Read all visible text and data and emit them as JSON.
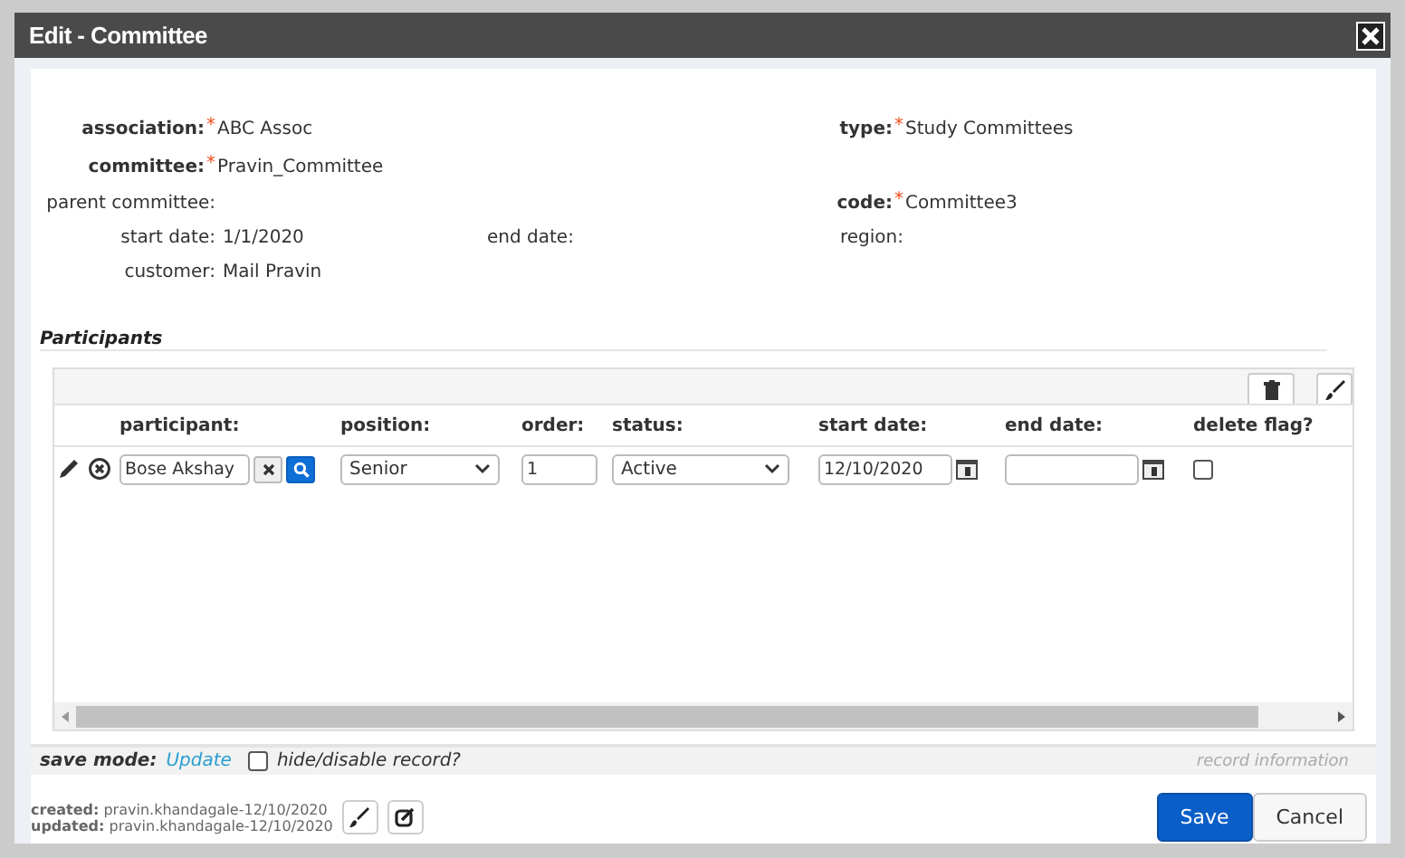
{
  "window": {
    "title": "Edit - Committee"
  },
  "field_rows": [
    {
      "left": {
        "label": "association:",
        "mark": "*",
        "value": "ABC Assoc",
        "strong": true
      },
      "right": {
        "label": "type:",
        "mark": "*",
        "value": "Study Committees",
        "strong": true
      }
    },
    {
      "left": {
        "label": "committee:",
        "mark": "*",
        "value": "Pravin_Committee",
        "strong": true
      }
    },
    {
      "left": {
        "label": "parent committee:",
        "strong": false
      },
      "right": {
        "label": "code:",
        "mark": "*",
        "value": "Committee3",
        "strong": true
      }
    },
    {
      "left": {
        "label": "start date:",
        "value": "1/1/2020",
        "strong": false
      },
      "middle": {
        "label": "end date:",
        "strong": false
      },
      "right": {
        "label": "region:",
        "strong": false
      }
    },
    {
      "left": {
        "label": "customer:",
        "value": "Mail Pravin",
        "strong": false
      }
    }
  ],
  "participants": {
    "title": "Participants",
    "columns": [
      "participant:",
      "position:",
      "order:",
      "status:",
      "start date:",
      "end date:",
      "delete flag?"
    ],
    "rows": [
      {
        "participant": "Bose Akshay",
        "position": "Senior",
        "order": "1",
        "status": "Active",
        "start_date": "12/10/2020",
        "end_date": "",
        "delete_flag": false
      }
    ]
  },
  "save_mode": {
    "label": "save mode:",
    "value": "Update",
    "hide_label": "hide/disable record?",
    "hide_checked": false,
    "record_info": "record information"
  },
  "audit": [
    {
      "label": "created:",
      "value": "pravin.khandagale-12/10/2020"
    },
    {
      "label": "updated:",
      "value": "pravin.khandagale-12/10/2020"
    }
  ],
  "buttons": [
    {
      "label": "Save",
      "primary": true
    },
    {
      "label": "Cancel",
      "primary": false
    }
  ]
}
